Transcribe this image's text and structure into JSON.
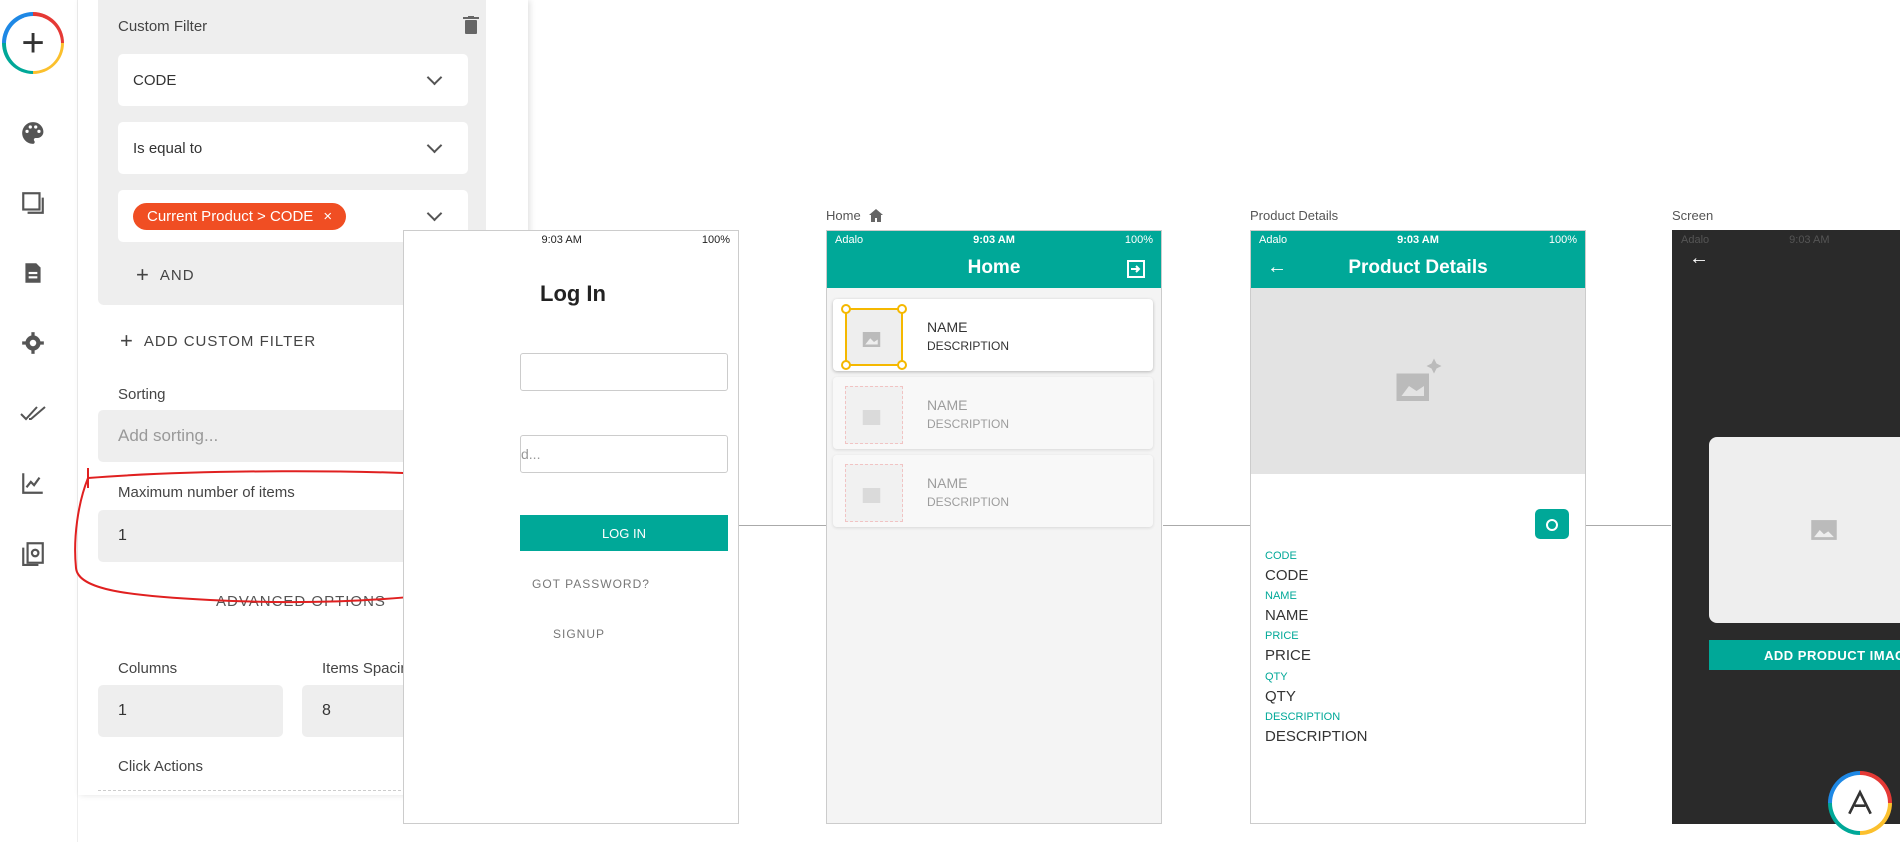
{
  "panel": {
    "filter_title": "Custom Filter",
    "field_value": "CODE",
    "operator_value": "Is equal to",
    "chip_text": "Current Product > CODE",
    "chip_remove": "×",
    "and_label": "AND",
    "add_custom_filter": "ADD CUSTOM FILTER",
    "sorting_label": "Sorting",
    "sorting_placeholder": "Add sorting...",
    "max_items_label": "Maximum number of items",
    "max_items_value": "1",
    "advanced_options": "ADVANCED OPTIONS",
    "columns_label": "Columns",
    "columns_value": "1",
    "spacing_label": "Items Spacing",
    "spacing_value": "8",
    "click_actions_label": "Click Actions"
  },
  "login_screen": {
    "time": "9:03 AM",
    "battery": "100%",
    "title": "Log In",
    "field_hint": "d...",
    "login_button": "LOG IN",
    "forgot": "GOT PASSWORD?",
    "signup": "SIGNUP"
  },
  "home_screen": {
    "label": "Home",
    "carrier": "Adalo",
    "time": "9:03 AM",
    "battery": "100%",
    "title": "Home",
    "items": [
      {
        "name": "NAME",
        "desc": "DESCRIPTION"
      },
      {
        "name": "NAME",
        "desc": "DESCRIPTION"
      },
      {
        "name": "NAME",
        "desc": "DESCRIPTION"
      }
    ]
  },
  "details_screen": {
    "label": "Product Details",
    "carrier": "Adalo",
    "time": "9:03 AM",
    "battery": "100%",
    "title": "Product Details",
    "fields": [
      {
        "label": "CODE",
        "value": "CODE"
      },
      {
        "label": "NAME",
        "value": "NAME"
      },
      {
        "label": "PRICE",
        "value": "PRICE"
      },
      {
        "label": "QTY",
        "value": "QTY"
      },
      {
        "label": "DESCRIPTION",
        "value": "DESCRIPTION"
      }
    ]
  },
  "dark_screen": {
    "label": "Screen",
    "carrier": "Adalo",
    "time": "9:03 AM",
    "button": "ADD PRODUCT IMAG"
  },
  "colors": {
    "teal": "#00a898",
    "chip": "#f04e23",
    "annotation": "#e02020",
    "highlight": "#f5b800"
  }
}
